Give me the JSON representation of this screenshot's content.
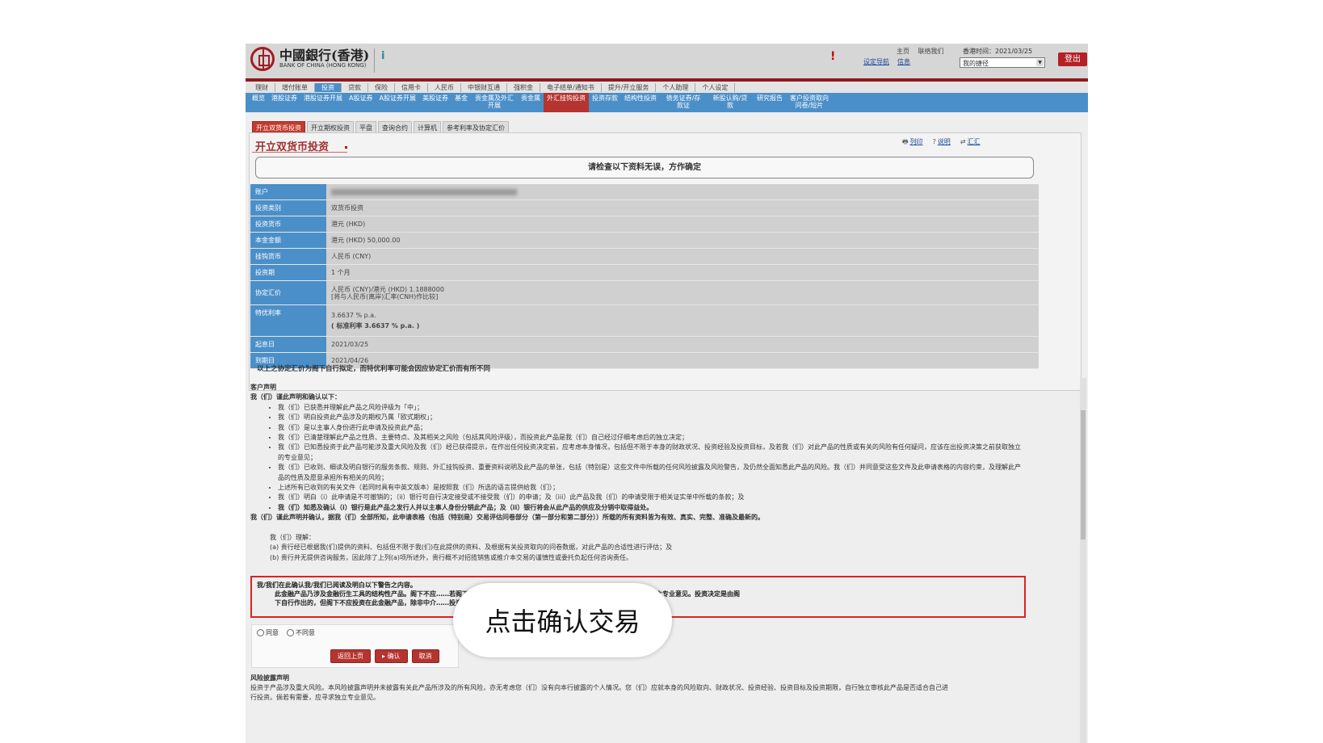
{
  "header": {
    "logo_cn": "中國銀行(香港)",
    "logo_en": "BANK OF CHINA (HONG KONG)",
    "top_links": [
      "主页",
      "联络我们"
    ],
    "hk_time": "香港时间：2021/03/25",
    "util_links": [
      "设定导航",
      "信息"
    ],
    "my_page": "我的捷径",
    "logout": "登出"
  },
  "nav1": [
    {
      "label": "理财"
    },
    {
      "label": "增付账单"
    },
    {
      "label": "投资",
      "active": true
    },
    {
      "label": "贷款"
    },
    {
      "label": "保险"
    },
    {
      "label": "信用卡"
    },
    {
      "label": "人民币"
    },
    {
      "label": "中银财互通"
    },
    {
      "label": "强积金"
    },
    {
      "label": "电子结单/通知书"
    },
    {
      "label": "提升/开立服务"
    },
    {
      "label": "个人助理"
    },
    {
      "label": "个人设定"
    }
  ],
  "nav2": [
    {
      "label": "概览"
    },
    {
      "label": "港股证券"
    },
    {
      "label": "港股证券开展"
    },
    {
      "label": "A股证券"
    },
    {
      "label": "A股证券开展"
    },
    {
      "label": "美股证券"
    },
    {
      "label": "基金"
    },
    {
      "label": "贵金属及外汇开展"
    },
    {
      "label": "贵金属"
    },
    {
      "label": "外汇挂钩投资",
      "active": true
    },
    {
      "label": "投资存款"
    },
    {
      "label": "结构性投资"
    },
    {
      "label": "债务证券/存款证"
    },
    {
      "label": "新股认购/贷款"
    },
    {
      "label": "研究报告"
    },
    {
      "label": "客户投资取向问卷/短片"
    }
  ],
  "subtabs": [
    {
      "label": "开立双货币投资",
      "active": true
    },
    {
      "label": "开立期权投资"
    },
    {
      "label": "平盘"
    },
    {
      "label": "查询合约"
    },
    {
      "label": "计算机"
    },
    {
      "label": "参考利率及协定汇价"
    }
  ],
  "page_title": "开立双货币投资",
  "tools": [
    "列印",
    "说明",
    "汇汇"
  ],
  "confirm_note": "请检查以下资料无误，方作确定",
  "details": {
    "account_label": "账户",
    "type_label": "投资类别",
    "type_value": "双货币投资",
    "ccy_label": "投资货币",
    "ccy_value": "港元 (HKD)",
    "principal_label": "本金金额",
    "principal_value": "港元 (HKD) 50,000.00",
    "linked_label": "挂钩货币",
    "linked_value": "人民币 (CNY)",
    "period_label": "投资期",
    "period_value": "1 个月",
    "rate_label": "协定汇价",
    "rate_value": "人民币 (CNY)/港元 (HKD) 1.1888000",
    "rate_sub": "[将与人民币(离岸)汇率(CNH)作比较]",
    "yield_label": "特优利率",
    "yield_value": "3.6637 % p.a.",
    "yield_std": "( 标准利率 3.6637 % p.a. )",
    "start_label": "起息日",
    "start_value": "2021/03/25",
    "end_label": "到期日",
    "end_value": "2021/04/26"
  },
  "rate_note": "以上之协定汇价为阁下自行拟定，而特优利率可能会因应协定汇价而有所不同",
  "declaration": {
    "heading": "客户声明",
    "sub": "我（们）谨此声明和确认以下：",
    "items": [
      "我（们）已获悉并理解此产品之风险评级为「中」；",
      "我（们）明白投资此产品涉及的期权乃属「欧式期权」；",
      "我（们）是以主事人身份进行此申请及投资此产品；",
      "我（们）已清楚理解此产品之性质、主要特点、及其相关之风险（包括其风险评级），而投资此产品是我（们）自己经过仔细考虑后的独立决定；",
      "我（们）已知悉投资于此产品可能涉及重大风险及我（们）经已获得提示，在作出任何投资决定前，应考虑本身情况，包括但不限于本身的财政状况、投资经验及投资目标，及若我（们）对此产品的性质或有关的风险有任何疑问，应该在出投资决策之前获取独立的专业意见；",
      "我（们）已收到、细读及明白银行的服务条款、规则、外汇挂钩投资、重要资料说明及此产品的单张，包括（特别是）这些文件中所载的任何风险披露及风险警告，及仍然全面知悉此产品的风险。我（们）并同意受这些文件及此申请表格的内容约束，及理解此产品的性质及愿意承担所有相关的风险；",
      "上述所有已收到的有关文件（若同时具有中英文版本）是按照我（们）所选的语言提供给我（们）；",
      "我（们）明白（i）此申请是不可撤销的；（ii）银行可自行决定接受或不接受我（们）的申请；及（iii）此产品及我（们）的申请受限于相关证实单中所载的条款；及"
    ],
    "bold_item": "我（们）知悉及确认（i）银行是此产品之发行人并以主事人身份分销此产品；及（ii）银行将会从此产品的供应及分销中取得益处。",
    "bold_line": "我（们）谨此声明并确认，据我（们）全部所知，此申请表格（包括（特别是）交易评估问卷部分（第一部分和第二部分））所载的所有资料皆为有效、真实、完整、准确及最新的。",
    "understand_h": "我（们）理解：",
    "understand_a": "(a) 贵行经已根据我(们)提供的资料、包括但不限于我(们)在此提供的资料、及根据有关投资取向的问卷数据，对此产品的合适性进行评估；及",
    "understand_b": "(b) 贵行并无提供咨询服务，因此除了上列(a)项所述外，贵行概不对招揽销售或推介本交易的谨慎性或委托负起任何咨询责任。"
  },
  "warning": {
    "heading": "我/我们在此确认我/我们已阅读及明白以下警告之内容。",
    "line1": "此金融产品乃涉及金融衍生工具的结构性产品。阁下不应……若阁下对此产品涉及的风险有任何疑问，可要求中介人加以澄清或寻求独立专业意见。投资决定是由阁",
    "line2": "下自行作出的，但阁下不应投资在此金融产品，除非中介……投资经验及目标后，此金融产品是适合阁下的。"
  },
  "agree": {
    "agree_label": "同意",
    "disagree_label": "不同意",
    "back": "返回上页",
    "confirm": "确认",
    "cancel": "取消"
  },
  "risk": {
    "heading": "风险披露声明",
    "text1": "投资于产品涉及重大风险。本风险披露声明并未披露有关此产品所涉及的所有风险，亦无考虑您（们）没有向本行披露的个人情况。您（们）应就本身的风险取向、财政状况、投资经验、投资目标及投资期限，自行独立审核此产品是否适合自己进",
    "text2": "行投资。倘若有需要，应寻求独立专业意见。"
  },
  "callout": "点击确认交易"
}
